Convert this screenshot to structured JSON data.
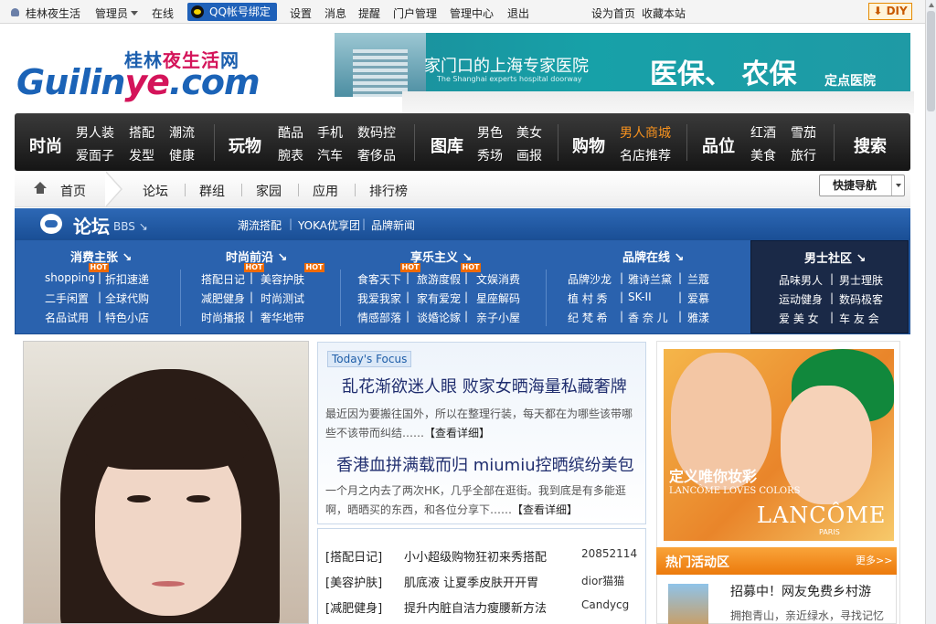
{
  "topbar": {
    "site_name": "桂林夜生活",
    "admin": "管理员",
    "online": "在线",
    "qq_bind": "QQ帐号绑定",
    "settings": "设置",
    "messages": "消息",
    "reminders": "提醒",
    "portal_admin": "门户管理",
    "admin_center": "管理中心",
    "logout": "退出",
    "set_home": "设为首页",
    "bookmark": "收藏本站",
    "diy": "DIY"
  },
  "logo": {
    "cn_prefix": "桂林",
    "cn_red": "夜生活",
    "cn_suffix": "网",
    "en_left": "Guilin",
    "en_mid": "ye",
    "en_right": ".com"
  },
  "banner": {
    "line1": "家门口的上海专家医院",
    "line1_sub": "The Shanghai experts hospital doorway",
    "line2": "医保、 农保",
    "line3": "定点医院"
  },
  "nav": {
    "sections": [
      {
        "title": "时尚",
        "items": [
          "男人装",
          "搭配",
          "潮流",
          "爱面子",
          "发型",
          "健康"
        ]
      },
      {
        "title": "玩物",
        "items": [
          "酷品",
          "手机",
          "数码控",
          "腕表",
          "汽车",
          "奢侈品"
        ]
      },
      {
        "title": "图库",
        "items": [
          "男色",
          "美女",
          "秀场",
          "画报"
        ]
      },
      {
        "title": "购物",
        "items": [
          "男人商城",
          "名店推荐"
        ]
      },
      {
        "title": "品位",
        "items": [
          "红酒",
          "雪茄",
          "美食",
          "旅行"
        ]
      },
      {
        "title": "搜索",
        "items": []
      }
    ],
    "highlight_color": "#f7921e"
  },
  "crumb": {
    "home": "首页",
    "items": [
      "论坛",
      "群组",
      "家园",
      "应用",
      "排行榜"
    ],
    "quick_nav": "快捷导航"
  },
  "forumbar": {
    "title": "论坛",
    "sub": "BBS",
    "links": [
      "潮流搭配",
      "YOKA优享团",
      "品牌新闻"
    ]
  },
  "cats": {
    "hot_label": "HOT",
    "columns": [
      {
        "head": "消费主张",
        "rows": [
          [
            "shopping",
            "折扣速递"
          ],
          [
            "二手闲置",
            "全球代购"
          ],
          [
            "名品试用",
            "特色小店"
          ]
        ]
      },
      {
        "head": "时尚前沿",
        "rows": [
          [
            "搭配日记",
            "美容护肤"
          ],
          [
            "减肥健身",
            "时尚测试"
          ],
          [
            "时尚播报",
            "奢华地带"
          ]
        ]
      },
      {
        "head": "享乐主义",
        "rows": [
          [
            "食客天下",
            "旅游度假"
          ],
          [
            "我爱我家",
            "家有爱宠"
          ],
          [
            "情感部落",
            "谈婚论嫁"
          ]
        ],
        "third": [
          "文娱消费",
          "星座解码",
          "亲子小屋"
        ]
      },
      {
        "head": "品牌在线",
        "rows": [
          [
            "品牌沙龙",
            "雅诗兰黛",
            "兰蔻"
          ],
          [
            "植 村 秀",
            "SK-II",
            "爱慕"
          ],
          [
            "纪 梵 希",
            "香 奈 儿",
            "雅漾"
          ]
        ]
      },
      {
        "head": "男士社区",
        "rows": [
          [
            "品味男人",
            "男士理肤"
          ],
          [
            "运动健身",
            "数码极客"
          ],
          [
            "爱 美 女",
            "车 友 会"
          ]
        ]
      }
    ]
  },
  "focus": {
    "tag": "Today's Focus",
    "headline1": "乱花渐欲迷人眼 败家女晒海量私藏奢牌",
    "summary1": "最近因为要搬往国外，所以在整理行装，每天都在为哪些该带哪些不该带而纠结……",
    "more1": "【查看详细】",
    "headline2": "香港血拼满载而归 miumiu控晒缤纷美包",
    "summary2": "一个月之内去了两次HK，几乎全部在逛街。我到底是有多能逛啊，晒晒买的东西，和各位分享下……",
    "more2": "【查看详细】"
  },
  "list": [
    {
      "cat": "[搭配日记]",
      "title": "小小超级购物狂初来秀搭配",
      "author": "20852114"
    },
    {
      "cat": "[美容护肤]",
      "title": "肌底液 让夏季皮肤开开胃",
      "author": "dior猫猫"
    },
    {
      "cat": "[减肥健身]",
      "title": "提升内脏自洁力瘦腰新方法",
      "author": "Candycg"
    }
  ],
  "ad": {
    "slogan": "定义唯你妆彩",
    "slogan_en": "LANCÔME LOVES COLORS",
    "brand": "LANCÔME",
    "brand_city": "PARIS"
  },
  "activity": {
    "title": "热门活动区",
    "more": "更多>>",
    "item_title": "招募中！网友免费乡村游",
    "item_sub": "拥抱青山，亲近绿水，寻找记忆"
  }
}
